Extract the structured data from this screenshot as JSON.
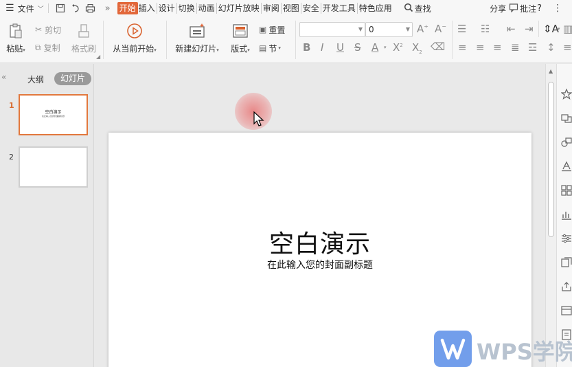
{
  "menubar": {
    "file_label": "文件",
    "tabs": [
      "开始",
      "插入",
      "设计",
      "切换",
      "动画",
      "幻灯片放映",
      "审阅",
      "视图",
      "安全",
      "开发工具",
      "特色应用"
    ],
    "active_tab": "开始",
    "search_label": "查找",
    "share_label": "分享",
    "comment_label": "批注"
  },
  "ribbon": {
    "paste_label": "粘贴",
    "cut_label": "剪切",
    "copy_label": "复制",
    "format_painter_label": "格式刷",
    "play_from_current_label": "从当前开始",
    "new_slide_label": "新建幻灯片",
    "layout_label": "版式",
    "reset_label": "重置",
    "section_label": "节",
    "font_name_value": "",
    "font_size_value": "0"
  },
  "left_panel": {
    "outline_tab": "大纲",
    "slides_tab": "幻灯片",
    "slides": [
      {
        "number": "1",
        "title": "空白演示",
        "subtitle": "在此输入您的封面副标题"
      },
      {
        "number": "2",
        "title": "",
        "subtitle": ""
      }
    ]
  },
  "slide": {
    "title": "空白演示",
    "subtitle": "在此输入您的封面副标题"
  },
  "watermark": {
    "text": "WPS学院"
  },
  "colors": {
    "accent": "#e2673a",
    "selected_thumb_border": "#e2783d",
    "click_highlight": "#e88080",
    "wps_blue": "#5a8ee8"
  }
}
